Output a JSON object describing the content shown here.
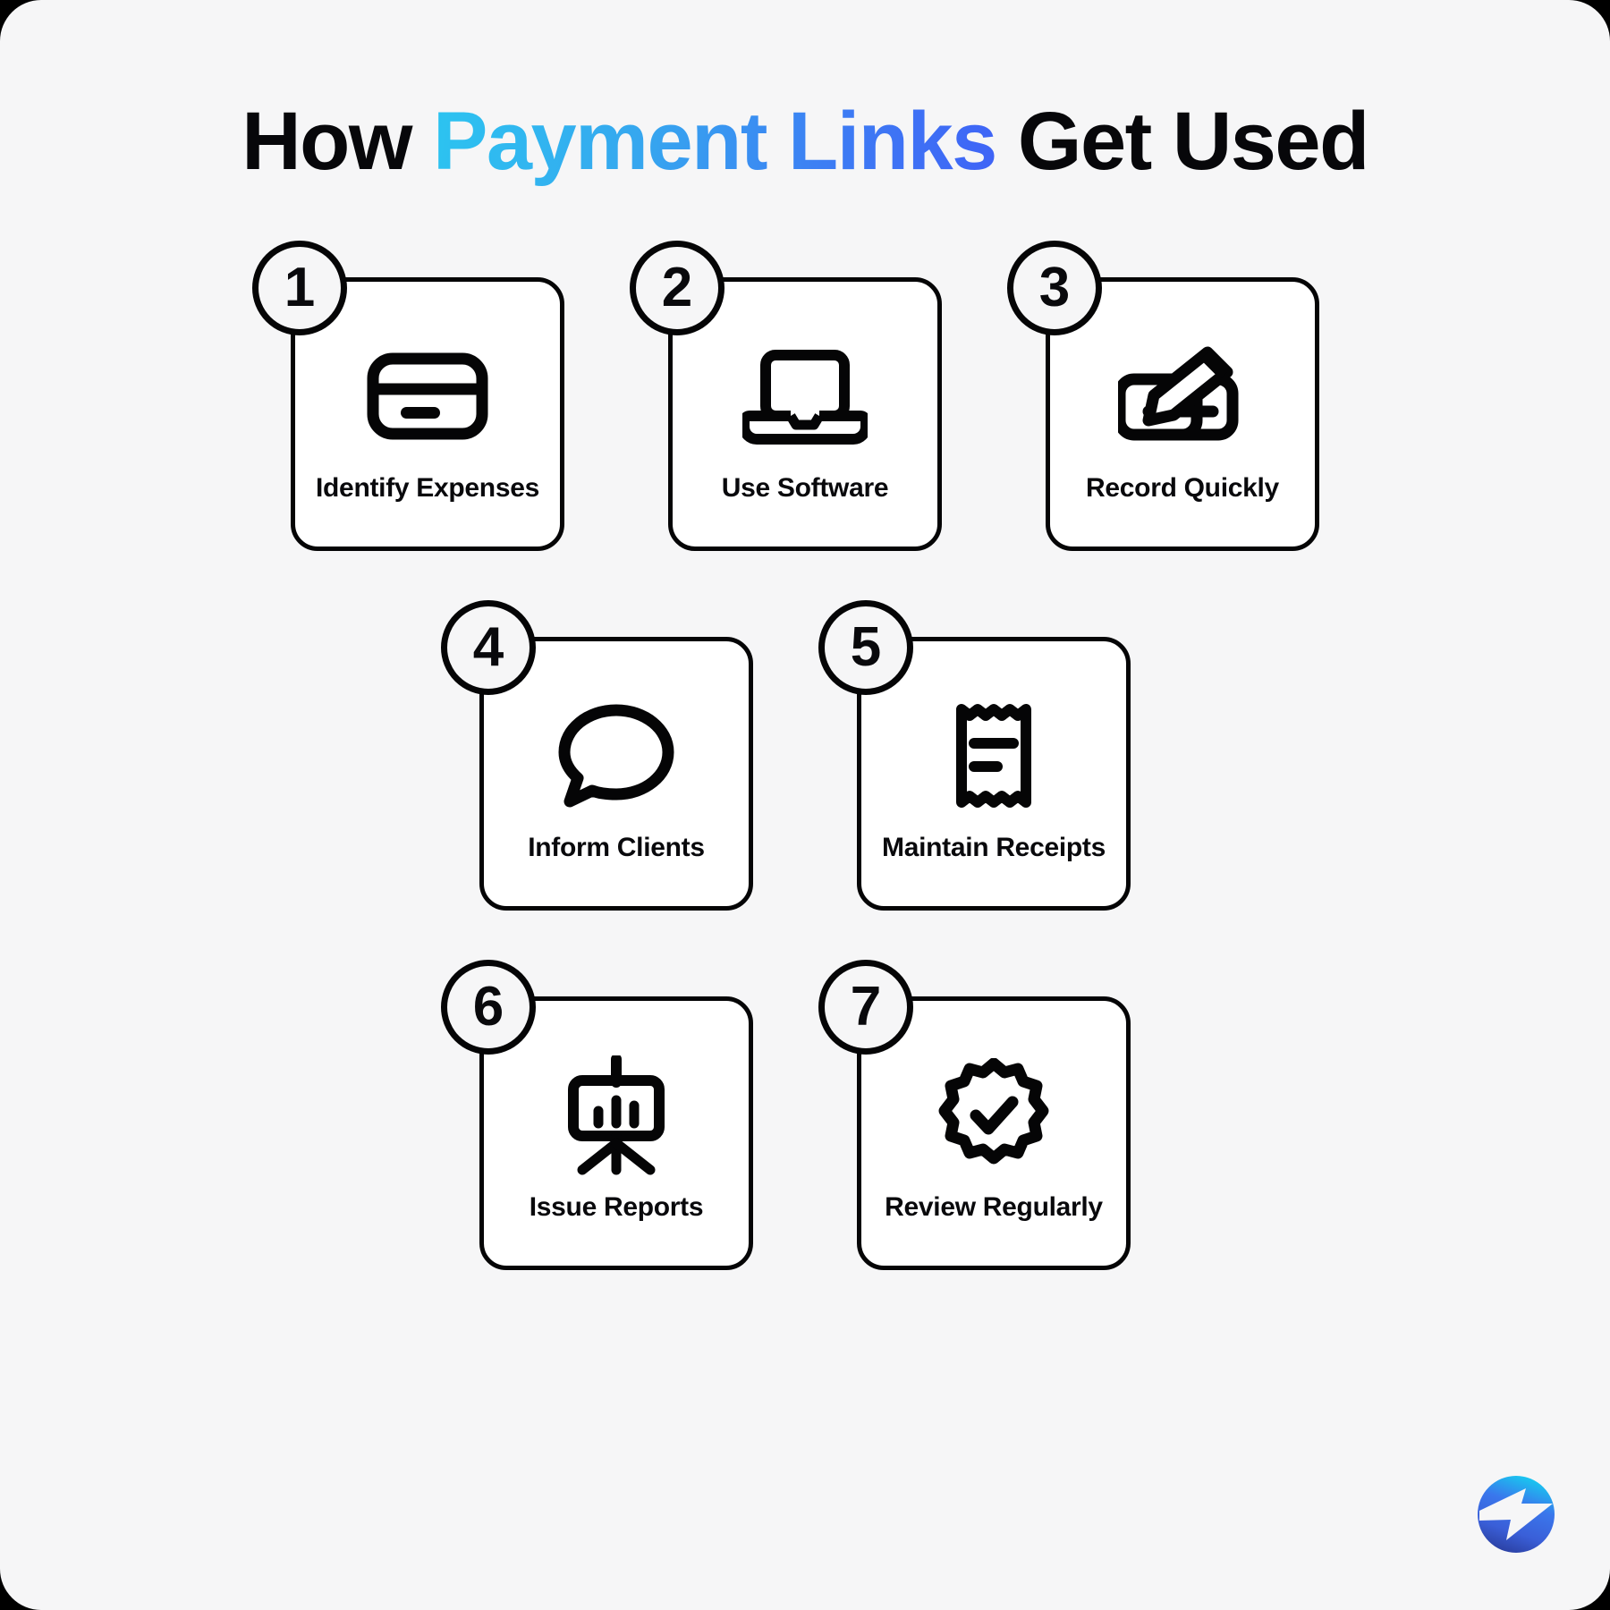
{
  "page": {
    "background_color": "#f6f6f7",
    "outer_color": "#000000",
    "corner_radius_px": 46
  },
  "title": {
    "part1": "How ",
    "accent": "Payment Links",
    "part2": " Get Used",
    "full_text": "How Payment Links Get Used",
    "color": "#07070a",
    "accent_gradient_from": "#2cc4f0",
    "accent_gradient_to": "#3f63f6"
  },
  "steps": [
    {
      "number": "1",
      "label": "Identify Expenses",
      "icon": "credit-card-icon"
    },
    {
      "number": "2",
      "label": "Use Software",
      "icon": "laptop-icon"
    },
    {
      "number": "3",
      "label": "Record Quickly",
      "icon": "card-with-pen-icon"
    },
    {
      "number": "4",
      "label": "Inform Clients",
      "icon": "speech-bubble-icon"
    },
    {
      "number": "5",
      "label": "Maintain Receipts",
      "icon": "receipt-icon"
    },
    {
      "number": "6",
      "label": "Issue Reports",
      "icon": "presentation-chart-icon"
    },
    {
      "number": "7",
      "label": "Review Regularly",
      "icon": "verified-badge-icon"
    }
  ],
  "logo": {
    "name": "lightning-bolt-circle-logo",
    "gradient_from": "#18c8f0",
    "gradient_mid": "#3a6ae8",
    "gradient_to": "#2a3e9e"
  }
}
